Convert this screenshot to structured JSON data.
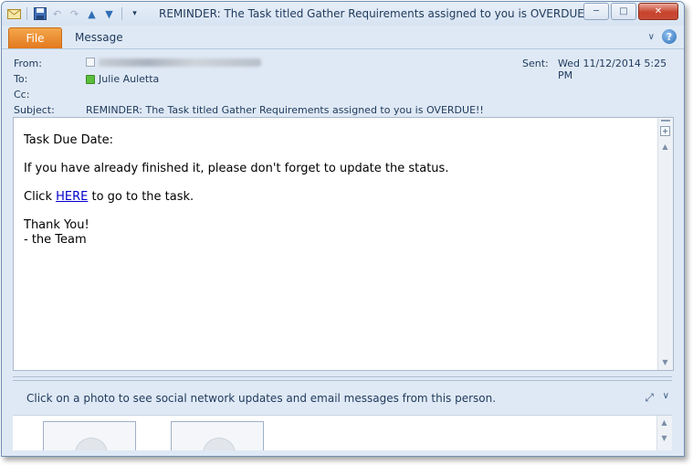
{
  "window": {
    "title": "REMINDER: The Task titled Gather Requirements assigned to you is OVERDUE!!  -  Me..."
  },
  "ribbon": {
    "tabs": [
      {
        "label": "File",
        "active": true
      },
      {
        "label": "Message",
        "active": false
      }
    ]
  },
  "header": {
    "from_label": "From:",
    "to_label": "To:",
    "to_value": "Julie Auletta",
    "cc_label": "Cc:",
    "subject_label": "Subject:",
    "subject_value": "REMINDER: The Task titled Gather Requirements assigned to you is OVERDUE!!",
    "sent_label": "Sent:",
    "sent_value": "Wed 11/12/2014 5:25 PM"
  },
  "body": {
    "line1": "Task Due Date:",
    "line2": "If you have already finished it, please don't forget to update the status.",
    "click_prefix": "Click ",
    "link_text": "HERE",
    "click_suffix": " to go to the task.",
    "thanks": "Thank You!",
    "signature": "- the Team"
  },
  "people_pane": {
    "text": "Click on a photo to see social network updates and email messages from this person."
  },
  "colors": {
    "file_tab": "#e3791f",
    "link": "#0000cc",
    "presence": "#5bbf3a",
    "close_button": "#c7442e"
  },
  "icons": {
    "qat": [
      "mail-app-icon",
      "save-icon",
      "undo-icon",
      "redo-icon",
      "previous-item-icon",
      "next-item-icon",
      "customize-toolbar-icon"
    ],
    "window_controls": [
      "minimize-icon",
      "maximize-icon",
      "close-icon"
    ]
  }
}
